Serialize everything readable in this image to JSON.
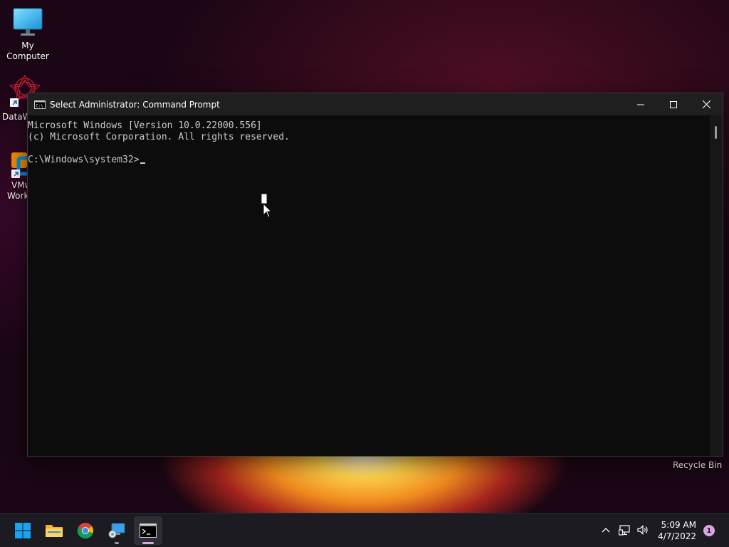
{
  "desktop": {
    "icons": [
      {
        "label": "My Computer",
        "icon": "monitor-icon"
      },
      {
        "label": "DataW",
        "icon": "datawrapper-icon"
      },
      {
        "label": "VMw",
        "label2": "Works",
        "icon": "vmware-icon"
      }
    ],
    "recycle_bin_label": "Recycle Bin"
  },
  "cmd_window": {
    "title": "Select Administrator: Command Prompt",
    "lines": [
      "Microsoft Windows [Version 10.0.22000.556]",
      "(c) Microsoft Corporation. All rights reserved.",
      "",
      "C:\\Windows\\system32>"
    ]
  },
  "taskbar": {
    "items": [
      {
        "name": "start",
        "icon": "windows-logo-icon"
      },
      {
        "name": "file-explorer",
        "icon": "folder-icon"
      },
      {
        "name": "chrome",
        "icon": "chrome-icon"
      },
      {
        "name": "network-app",
        "icon": "network-computer-icon"
      },
      {
        "name": "command-prompt",
        "icon": "cmd-icon",
        "active": true
      }
    ],
    "tray": {
      "time": "5:09 AM",
      "date": "4/7/2022",
      "notification_count": "1"
    }
  },
  "colors": {
    "accent": "#d9a7e6",
    "taskbar_bg": "#1c1b22",
    "console_bg": "#0c0c0c",
    "console_text": "#cccccc"
  }
}
